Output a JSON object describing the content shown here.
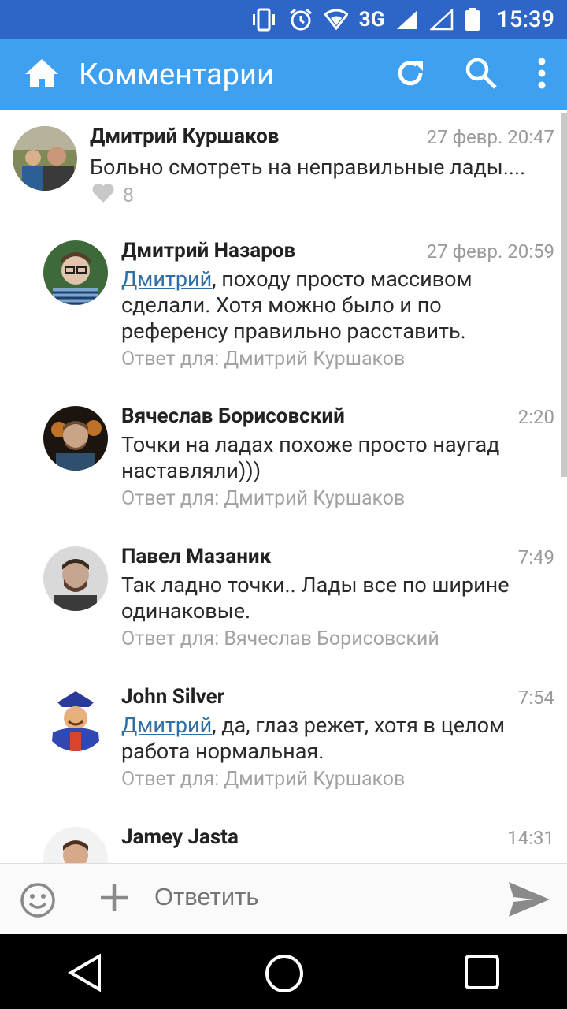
{
  "status_bar": {
    "network": "3G",
    "time": "15:39"
  },
  "toolbar": {
    "title": "Комментарии",
    "icons": [
      "home-icon",
      "refresh-icon",
      "search-icon",
      "more-vert-icon"
    ]
  },
  "comments": [
    {
      "author": "Дмитрий Куршаков",
      "time": "27 февр. 20:47",
      "text": "Больно смотреть на неправильные лады....",
      "likes": "8"
    },
    {
      "author": "Дмитрий Назаров",
      "time": "27 февр. 20:59",
      "mention": "Дмитрий",
      "text": ", походу просто массивом сделали. Хотя можно было и по референсу правильно расставить.",
      "reply_to": "Ответ для: Дмитрий Куршаков"
    },
    {
      "author": "Вячеслав Борисовский",
      "time": "2:20",
      "text": "Точки на ладах похоже просто наугад наставляли)))",
      "reply_to": "Ответ для: Дмитрий Куршаков"
    },
    {
      "author": "Павел Мазаник",
      "time": "7:49",
      "text": "Так ладно точки.. Лады все по ширине одинаковые.",
      "reply_to": "Ответ для: Вячеслав Борисовский"
    },
    {
      "author": "John Silver",
      "time": "7:54",
      "mention": "Дмитрий",
      "text": ", да, глаз режет, хотя в целом работа нормальная.",
      "reply_to": "Ответ для: Дмитрий Куршаков"
    },
    {
      "author": "Jamey Jasta",
      "time": "14:31"
    }
  ],
  "composer": {
    "placeholder": "Ответить"
  },
  "colors": {
    "status_bar": "#2e66c8",
    "toolbar": "#3ea0ee",
    "mention": "#2e6fa8"
  }
}
